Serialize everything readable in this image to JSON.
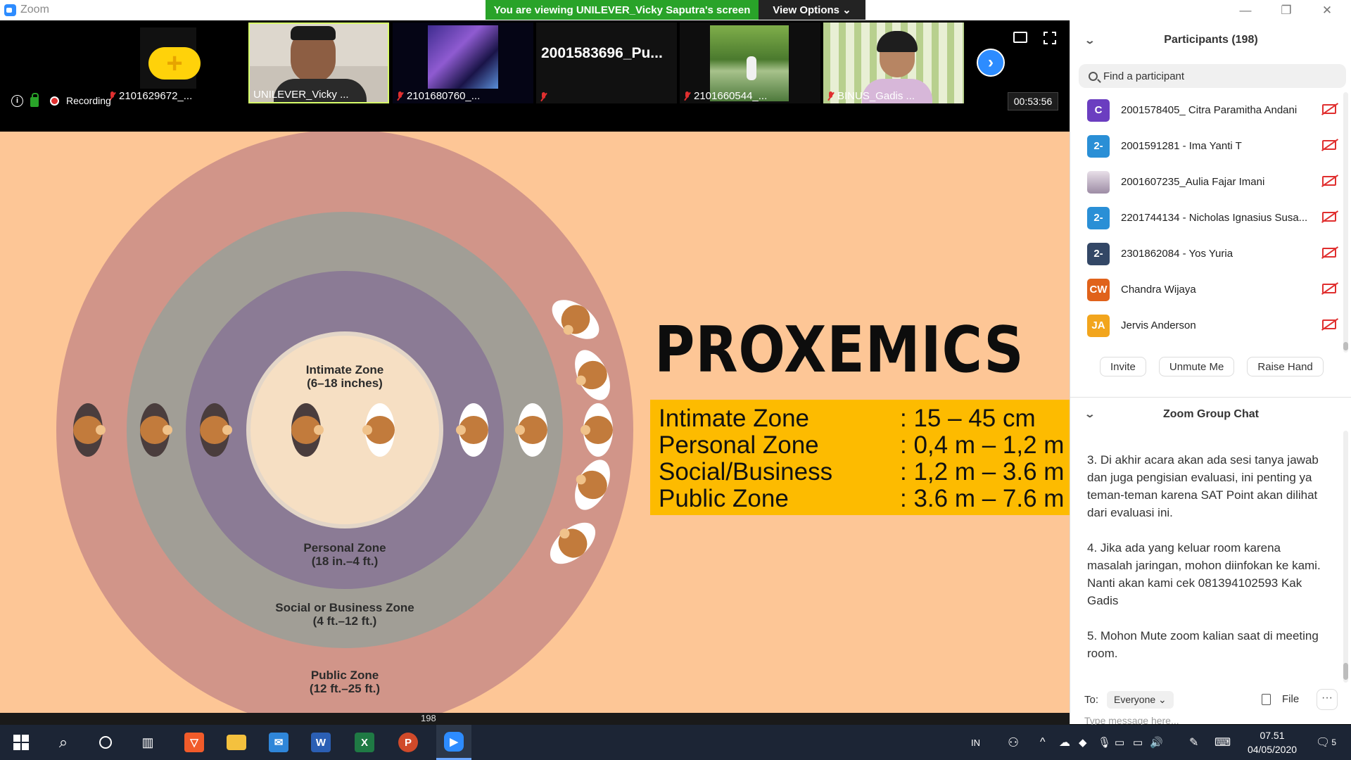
{
  "titlebar": {
    "app_name": "Zoom",
    "viewing_banner": "You are viewing UNILEVER_Vicky Saputra's screen",
    "view_options": "View Options ⌄",
    "minimize": "—",
    "restore": "❐",
    "close": "✕"
  },
  "thumbnails": [
    {
      "name": "2101629672_...",
      "muted": true
    },
    {
      "name": "UNILEVER_Vicky ...",
      "muted": false
    },
    {
      "name": "2101680760_...",
      "muted": true
    },
    {
      "name": "2001583696_Pu...",
      "muted": true
    },
    {
      "name": "2101660544_...",
      "muted": true
    },
    {
      "name": "BINUS_Gadis ...",
      "muted": true
    }
  ],
  "status": {
    "info_icon": "i",
    "recording": "Recording",
    "timer": "00:53:56"
  },
  "slide": {
    "title": "PROXEMICS",
    "zones": [
      {
        "name": "Intimate Zone",
        "range": ": 15 – 45 cm"
      },
      {
        "name": "Personal Zone",
        "range": ": 0,4 m – 1,2 m"
      },
      {
        "name": "Social/Business",
        "range": ": 1,2 m – 3.6 m"
      },
      {
        "name": "Public Zone",
        "range": ": 3.6 m – 7.6 m"
      }
    ],
    "circle_labels": {
      "intimate": "Intimate Zone\n(6–18 inches)",
      "personal": "Personal Zone\n(18 in.–4 ft.)",
      "social": "Social or Business Zone\n(4 ft.–12 ft.)",
      "public": "Public Zone\n(12 ft.–25 ft.)"
    },
    "colors": {
      "background": "#fdc696",
      "public": "#d19589",
      "social": "#a19e96",
      "personal": "#8b7b95",
      "intimate": "#f6dfc3",
      "banner": "#fdbb00"
    }
  },
  "participants": {
    "header": "Participants (198)",
    "search_placeholder": "Find a participant",
    "items": [
      {
        "initials": "C",
        "color": "#6b3ec0",
        "name": "2001578405_ Citra Paramitha Andani"
      },
      {
        "initials": "2-",
        "color": "#2a8fd6",
        "name": "2001591281 - Ima Yanti T"
      },
      {
        "initials": "",
        "color": "#c7b8c7",
        "name": "2001607235_Aulia Fajar Imani"
      },
      {
        "initials": "2-",
        "color": "#2a8fd6",
        "name": "2201744134 - Nicholas Ignasius Susa..."
      },
      {
        "initials": "2-",
        "color": "#334766",
        "name": "2301862084 - Yos Yuria"
      },
      {
        "initials": "CW",
        "color": "#e0621b",
        "name": "Chandra Wijaya"
      },
      {
        "initials": "JA",
        "color": "#f2a51d",
        "name": "Jervis Anderson"
      }
    ],
    "buttons": [
      "Invite",
      "Unmute Me",
      "Raise Hand"
    ]
  },
  "chat": {
    "header": "Zoom Group Chat",
    "messages": [
      "3. Di akhir acara akan ada sesi tanya jawab dan juga pengisian evaluasi, ini penting ya teman-teman karena SAT Point akan dilihat dari evaluasi ini.",
      "4. Jika ada yang keluar room karena masalah jaringan, mohon diinfokan ke kami. Nanti akan kami cek 081394102593 Kak Gadis",
      "5. Mohon Mute zoom kalian saat di meeting room."
    ],
    "to_label": "To:",
    "recipient": "Everyone ⌄",
    "file_label": "File",
    "more_label": "···",
    "input_placeholder": "Type message here..."
  },
  "controls_strip": {
    "participants_count": "198"
  },
  "taskbar": {
    "language": "IN",
    "time": "07.51",
    "date": "04/05/2020",
    "notifications": "5",
    "apps": [
      "brave-icon",
      "file-explorer-icon",
      "mail-icon",
      "word-icon",
      "excel-icon",
      "powerpoint-icon",
      "zoom-icon"
    ]
  }
}
